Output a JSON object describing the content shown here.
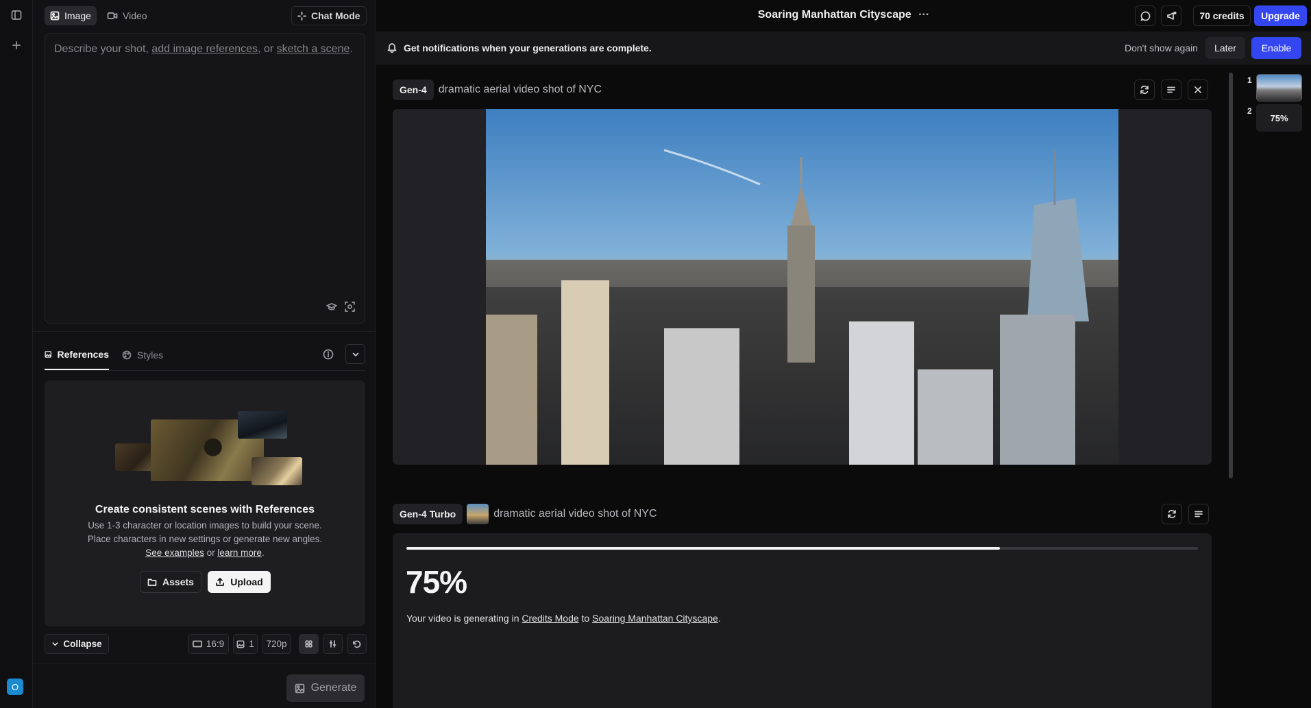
{
  "panel": {
    "tabs": [
      {
        "label": "Image"
      },
      {
        "label": "Video"
      }
    ],
    "chat_mode_label": "Chat Mode",
    "prompt": {
      "placeholder_pre": "Describe your shot,",
      "placeholder_link1": "add image references",
      "placeholder_mid": ", or",
      "placeholder_link2": "sketch a scene",
      "placeholder_post": "."
    },
    "sub_tabs": [
      {
        "label": "References"
      },
      {
        "label": "Styles"
      }
    ],
    "references_card": {
      "title": "Create consistent scenes with References",
      "line1": "Use 1-3 character or location images to build your scene.",
      "line2": "Place characters in new settings or generate new angles.",
      "see_examples": "See examples",
      "or": "or",
      "learn_more": "learn more",
      "period": ".",
      "assets_label": "Assets",
      "upload_label": "Upload"
    },
    "settings": {
      "collapse_label": "Collapse",
      "aspect_ratio": "16:9",
      "image_count": "1",
      "resolution": "720p"
    },
    "generate_label": "Generate"
  },
  "rail": {
    "avatar_letter": "O"
  },
  "topbar": {
    "title": "Soaring Manhattan Cityscape",
    "more": "···",
    "credits": "70 credits",
    "upgrade": "Upgrade"
  },
  "notification": {
    "message": "Get notifications when your generations are complete.",
    "dont_show": "Don't show again",
    "later": "Later",
    "enable": "Enable"
  },
  "generations": [
    {
      "model": "Gen-4",
      "prompt": "dramatic aerial video shot of NYC"
    },
    {
      "model": "Gen-4 Turbo",
      "prompt": "dramatic aerial video shot of NYC",
      "progress_percent": 75,
      "progress_label": "75%",
      "status_pre": "Your video is generating in",
      "status_mode": "Credits Mode",
      "status_to": "to",
      "status_project": "Soaring Manhattan Cityscape",
      "status_post": "."
    }
  ],
  "queue": [
    {
      "index": "1"
    },
    {
      "index": "2",
      "label": "75%"
    }
  ],
  "colors": {
    "accent": "#3446f0",
    "background": "#0b0b0c",
    "panel": "#121214"
  }
}
